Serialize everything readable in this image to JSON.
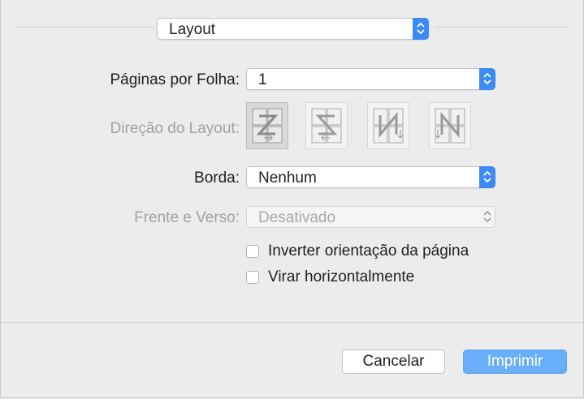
{
  "panel_select": {
    "value": "Layout"
  },
  "pages_per_sheet": {
    "label": "Páginas por Folha:",
    "value": "1"
  },
  "layout_direction": {
    "label": "Direção do Layout:",
    "options": [
      "z-shape",
      "reverse-z-shape",
      "reverse-n-shape",
      "n-shape"
    ],
    "selected": 0
  },
  "border": {
    "label": "Borda:",
    "value": "Nenhum"
  },
  "two_sided": {
    "label": "Frente e Verso:",
    "value": "Desativado"
  },
  "checkboxes": [
    {
      "label": "Inverter orientação da página",
      "checked": false
    },
    {
      "label": "Virar horizontalmente",
      "checked": false
    }
  ],
  "buttons": {
    "cancel": "Cancelar",
    "print": "Imprimir"
  },
  "colors": {
    "accent": "#3a8bf5",
    "primary_button": "#69aef8",
    "background": "#ececec"
  }
}
